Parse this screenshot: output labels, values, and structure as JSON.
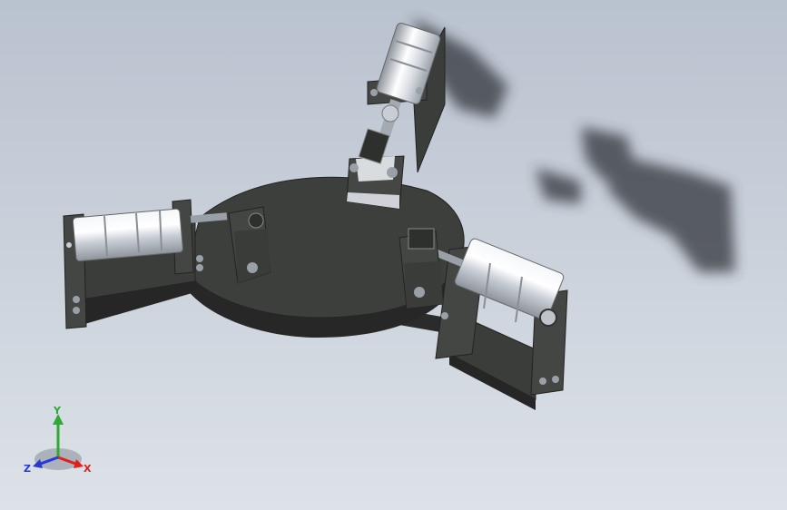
{
  "viewport": {
    "background_top": "#b9c2cf",
    "background_bottom": "#dde2e8",
    "part_color": "#3c3e3c",
    "cylinder_color": "#dfe3ea"
  },
  "model": {
    "cylinders": 3,
    "clamp_blocks": 3
  },
  "triad": {
    "x_label": "X",
    "y_label": "Y",
    "z_label": "Z",
    "x_color": "#e0201c",
    "y_color": "#2fa92f",
    "z_color": "#2638d8"
  }
}
